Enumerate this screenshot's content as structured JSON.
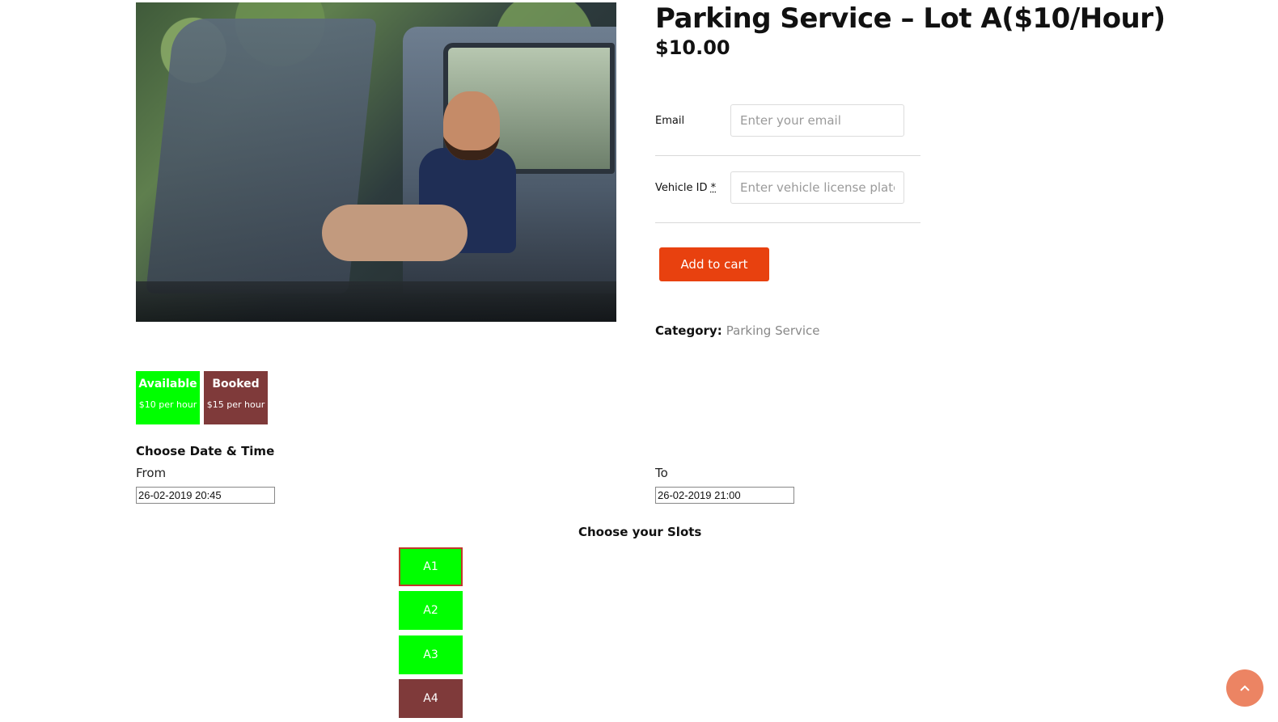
{
  "product": {
    "title": "Parking Service – Lot A($10/Hour)",
    "price": "$10.00",
    "image_alt": "Man sitting in car with door open"
  },
  "form": {
    "email_label": "Email",
    "email_placeholder": "Enter your email",
    "email_value": "",
    "vehicle_label": "Vehicle ID",
    "vehicle_required_marker": "*",
    "vehicle_placeholder": "Enter vehicle license plate",
    "vehicle_value": "",
    "add_to_cart_label": "Add to cart"
  },
  "meta": {
    "category_label": "Category:",
    "category_value": "Parking Service"
  },
  "legend": {
    "available_title": "Available",
    "available_rate": "$10 per hour",
    "booked_title": "Booked",
    "booked_rate": "$15 per hour"
  },
  "booking": {
    "date_heading": "Choose Date & Time",
    "from_label": "From",
    "from_value": "26-02-2019 20:45",
    "to_label": "To",
    "to_value": "26-02-2019 21:00",
    "slots_heading": "Choose your Slots"
  },
  "slots": [
    {
      "label": "A1",
      "status": "available",
      "selected": true
    },
    {
      "label": "A2",
      "status": "available",
      "selected": false
    },
    {
      "label": "A3",
      "status": "available",
      "selected": false
    },
    {
      "label": "A4",
      "status": "booked",
      "selected": false
    }
  ],
  "colors": {
    "available": "#00ff00",
    "booked": "#7f3a3a",
    "accent": "#e8410f",
    "scroll_top": "#ec8463"
  },
  "icons": {
    "scroll_top": "chevron-up-icon"
  }
}
